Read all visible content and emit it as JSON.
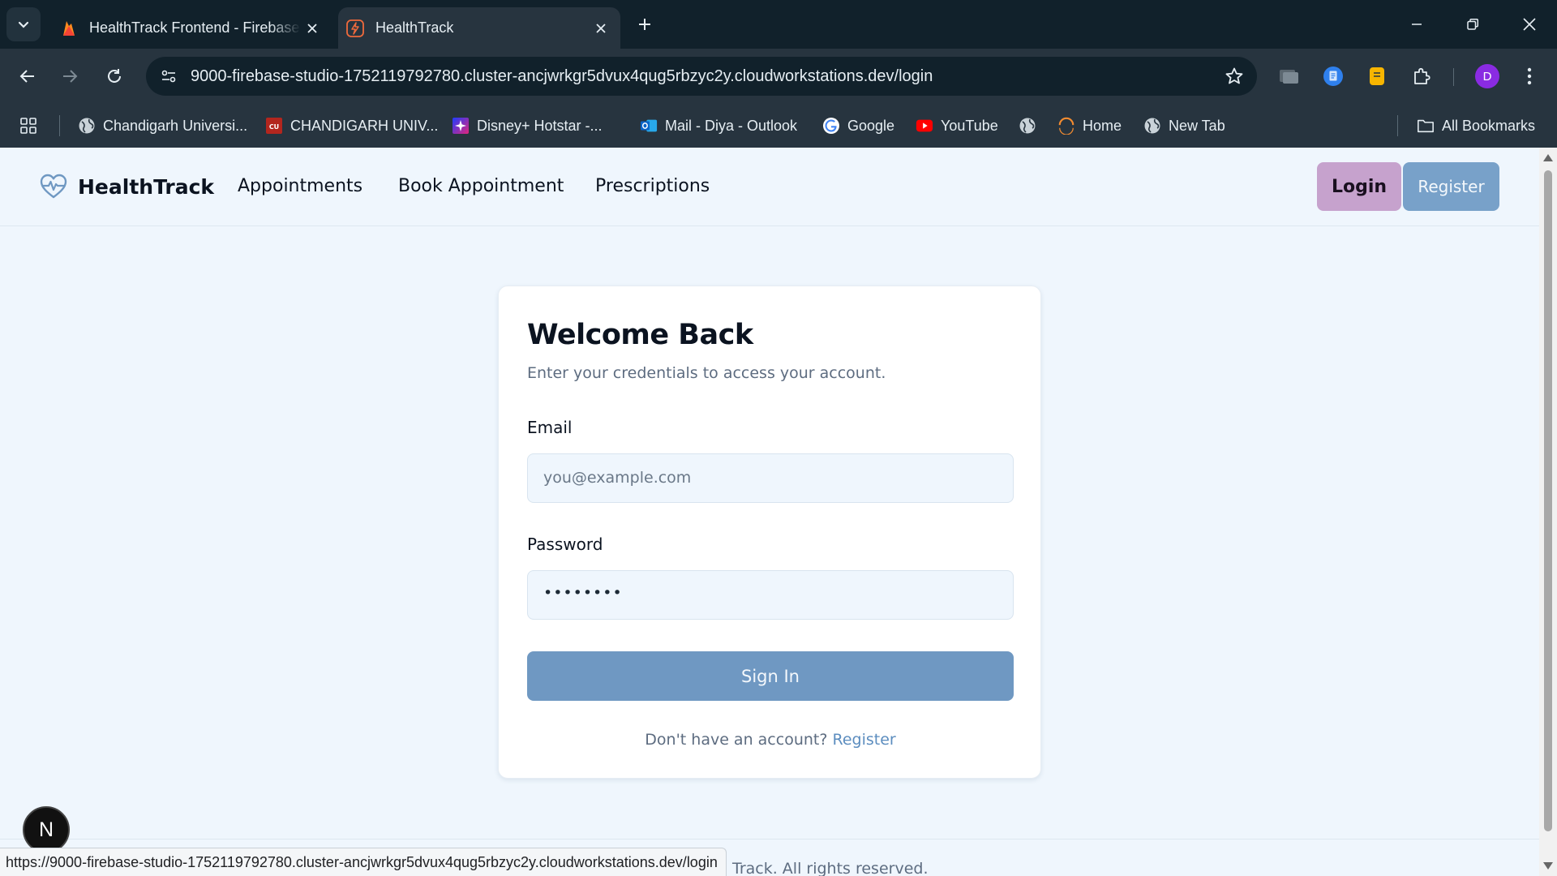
{
  "browser": {
    "tabs": [
      {
        "title": "HealthTrack Frontend - Firebase Studio",
        "icon": "firebase-icon",
        "active": false
      },
      {
        "title": "HealthTrack",
        "icon": "healthtrack-favicon",
        "active": true
      }
    ],
    "url": "9000-firebase-studio-1752119792780.cluster-ancjwrkgr5dvux4qug5rbzyc2y.cloudworkstations.dev/login",
    "profile_initial": "D",
    "bookmarks": [
      {
        "label": "Chandigarh Universi...",
        "icon": "globe-icon"
      },
      {
        "label": "CHANDIGARH UNIV...",
        "icon": "cu-logo-icon"
      },
      {
        "label": "Disney+ Hotstar -...",
        "icon": "hotstar-icon"
      },
      {
        "label": "Mail - Diya - Outlook",
        "icon": "outlook-icon"
      },
      {
        "label": "Google",
        "icon": "google-icon"
      },
      {
        "label": "YouTube",
        "icon": "youtube-icon"
      },
      {
        "label": "",
        "icon": "globe-icon"
      },
      {
        "label": "Home",
        "icon": "home-arc-icon"
      },
      {
        "label": "New Tab",
        "icon": "globe-icon"
      }
    ],
    "all_bookmarks_label": "All Bookmarks",
    "status_url": "https://9000-firebase-studio-1752119792780.cluster-ancjwrkgr5dvux4qug5rbzyc2y.cloudworkstations.dev/login"
  },
  "header": {
    "brand": "HealthTrack",
    "nav": [
      "Appointments",
      "Book Appointment",
      "Prescriptions"
    ],
    "login_label": "Login",
    "register_label": "Register"
  },
  "login_card": {
    "title": "Welcome Back",
    "subtitle": "Enter your credentials to access your account.",
    "email_label": "Email",
    "email_placeholder": "you@example.com",
    "password_label": "Password",
    "password_value": "••••••••",
    "submit_label": "Sign In",
    "footer_prompt": "Don't have an account?",
    "footer_link": "Register"
  },
  "footer": {
    "text_visible": "Track. All rights reserved."
  },
  "dev_badge": "N",
  "colors": {
    "page_bg": "#eff6fd",
    "login_button": "#c6a2cd",
    "primary": "#6f98c2",
    "link": "#5c8dbf",
    "chrome_dark": "#11212b",
    "chrome_toolbar": "#27343f"
  }
}
